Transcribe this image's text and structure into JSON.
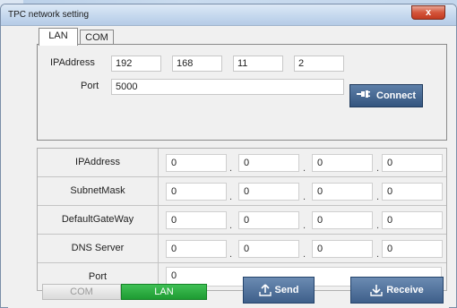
{
  "window": {
    "title": "TPC network setting",
    "close_glyph": "x"
  },
  "tabs": [
    {
      "label": "LAN"
    },
    {
      "label": "COM"
    }
  ],
  "connection": {
    "ip_label": "IPAddress",
    "ip": [
      "192",
      "168",
      "11",
      "2"
    ],
    "port_label": "Port",
    "port": "5000",
    "connect_label": "Connect"
  },
  "settings": {
    "rows": [
      {
        "label": "IPAddress",
        "values": [
          "0",
          "0",
          "0",
          "0"
        ]
      },
      {
        "label": "SubnetMask",
        "values": [
          "0",
          "0",
          "0",
          "0"
        ]
      },
      {
        "label": "DefaultGateWay",
        "values": [
          "0",
          "0",
          "0",
          "0"
        ]
      },
      {
        "label": "DNS Server",
        "values": [
          "0",
          "0",
          "0",
          "0"
        ]
      }
    ],
    "port_label": "Port",
    "port_value": "0",
    "separator": "."
  },
  "mode": {
    "com_label": "COM",
    "lan_label": "LAN",
    "active": "LAN"
  },
  "actions": {
    "send_label": "Send",
    "receive_label": "Receive"
  },
  "colors": {
    "lan_active": "#1e9b32",
    "button_blue": "#3e5f8a",
    "close_red": "#c23b21"
  },
  "icons": {
    "connect": "plug-icon",
    "send": "upload-icon",
    "receive": "download-icon"
  }
}
